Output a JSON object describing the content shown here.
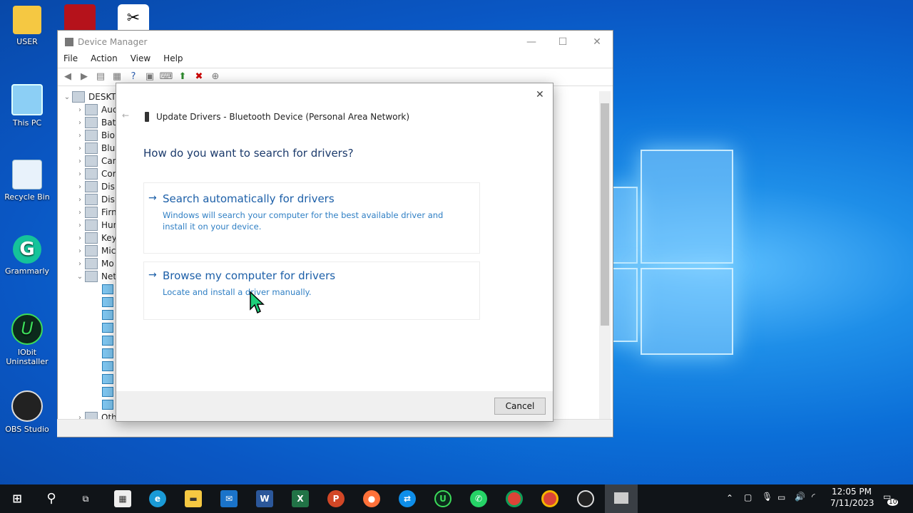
{
  "desktop": {
    "icons": [
      {
        "label": "USER"
      },
      {
        "label": "This PC"
      },
      {
        "label": "Recycle Bin"
      },
      {
        "label": "Grammarly"
      },
      {
        "label": "IObit\nUninstaller"
      },
      {
        "label": "OBS Studio"
      }
    ]
  },
  "device_manager": {
    "title": "Device Manager",
    "menu": [
      "File",
      "Action",
      "View",
      "Help"
    ],
    "tree_root": "DESKTO",
    "categories": [
      "Auc",
      "Bat",
      "Bio",
      "Blu",
      "Can",
      "Cor",
      "Disl",
      "Disp",
      "Firn",
      "Hun",
      "Key",
      "Mic",
      "Mo",
      "Net"
    ],
    "other_label": "Oth"
  },
  "dialog": {
    "title": "Update Drivers - Bluetooth Device (Personal Area Network)",
    "question": "How do you want to search for drivers?",
    "option1_title": "Search automatically for drivers",
    "option1_desc": "Windows will search your computer for the best available driver and install it on your device.",
    "option2_title": "Browse my computer for drivers",
    "option2_desc": "Locate and install a driver manually.",
    "cancel_label": "Cancel"
  },
  "taskbar": {
    "time": "12:05 PM",
    "date": "7/11/2023",
    "notification_count": "10"
  },
  "colors": {
    "accent_link": "#1c5fa8",
    "taskbar": "#101418"
  }
}
